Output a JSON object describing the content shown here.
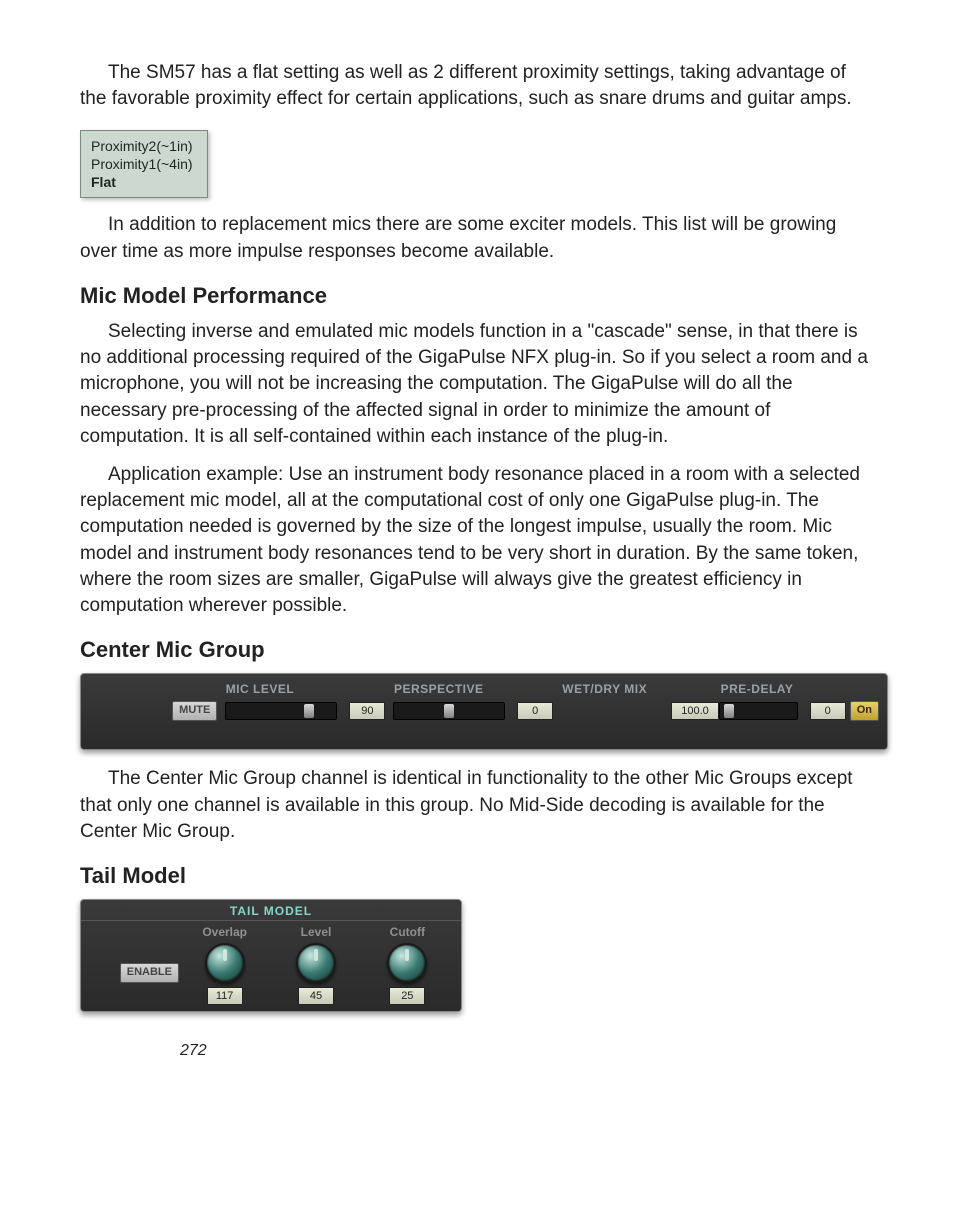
{
  "para1": "The SM57 has a flat setting as well as 2 different proximity settings, taking advantage of the favorable proximity effect for certain applications, such as snare drums and guitar amps.",
  "proximity_list": {
    "items": [
      "Proximity2(~1in)",
      "Proximity1(~4in)",
      "Flat"
    ],
    "selected_index": 2
  },
  "para2": "In addition to replacement mics there are some exciter models. This list will be growing over time as more impulse responses become available.",
  "heading1": "Mic Model Performance",
  "para3": "Selecting inverse and emulated mic models function in a \"cascade\" sense, in that there is no additional processing required of the GigaPulse NFX plug-in. So if you select a room and a microphone, you will not be increasing the computation. The GigaPulse will do all the necessary pre-processing of the affected signal in order to minimize the amount of computation. It is all self-contained within each instance of the plug-in.",
  "para4": "Application example: Use an instrument body resonance placed in a room with a selected replacement mic model, all at the computational cost of only one GigaPulse plug-in. The computation needed is governed by the size of the longest impulse, usually the room. Mic model and instrument body resonances tend to be very short in duration. By the same token, where the room sizes are smaller, GigaPulse will always give the greatest efficiency in computation wherever possible.",
  "heading2": "Center Mic Group",
  "mic_panel": {
    "headers": {
      "level": "MIC LEVEL",
      "perspective": "PERSPECTIVE",
      "wetdry": "WET/DRY MIX",
      "predelay": "PRE-DELAY"
    },
    "mute_label": "MUTE",
    "level_value": "90",
    "perspective_value": "0",
    "wetdry_value": "100.0",
    "predelay_value": "0",
    "on_label": "On"
  },
  "para5": "The Center Mic Group channel is identical in functionality to the other Mic Groups except that only one channel is available in this group. No Mid-Side decoding is available for the Center Mic Group.",
  "heading3": "Tail Model",
  "tail_panel": {
    "title": "TAIL MODEL",
    "enable_label": "ENABLE",
    "columns": [
      {
        "label": "Overlap",
        "value": "117"
      },
      {
        "label": "Level",
        "value": "45"
      },
      {
        "label": "Cutoff",
        "value": "25"
      }
    ]
  },
  "page_number": "272"
}
